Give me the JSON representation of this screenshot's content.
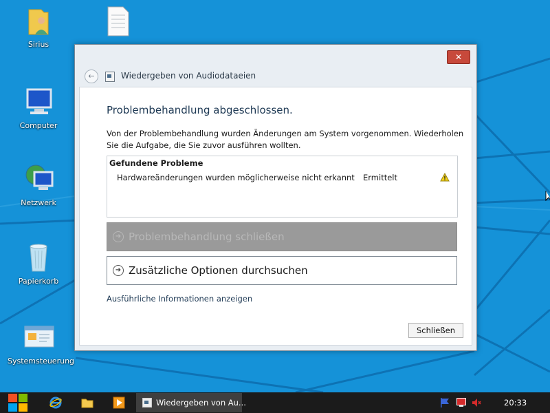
{
  "desktop": {
    "background": "#1592d8",
    "icons": [
      {
        "label": "Sirius",
        "icon": "user-folder-icon"
      },
      {
        "label": "",
        "icon": "text-document-icon"
      },
      {
        "label": "Computer",
        "icon": "computer-icon"
      },
      {
        "label": "Netzwerk",
        "icon": "network-icon"
      },
      {
        "label": "Papierkorb",
        "icon": "recycle-bin-icon"
      },
      {
        "label": "Systemsteuerung",
        "icon": "control-panel-icon"
      }
    ]
  },
  "window": {
    "title": "Wiedergeben von Audiodataeien",
    "close_color": "#c7493b",
    "heading": "Problembehandlung abgeschlossen.",
    "description": "Von der Problembehandlung wurden Änderungen am System vorgenommen. Wiederholen Sie die Aufgabe, die Sie zuvor ausführen wollten.",
    "problems": {
      "title": "Gefundene Probleme",
      "items": [
        {
          "text": "Hardwareänderungen wurden möglicherweise nicht erkannt",
          "status": "Ermittelt",
          "icon": "warning-icon"
        }
      ]
    },
    "commands": {
      "close_troubleshooter": "Problembehandlung schließen",
      "more_options": "Zusätzliche Optionen durchsuchen"
    },
    "details_link": "Ausführliche Informationen anzeigen",
    "close_button": "Schließen"
  },
  "taskbar": {
    "active_task": "Wiedergeben von Au...",
    "clock": "20:33",
    "pinned": [
      "internet-explorer-icon",
      "file-explorer-icon",
      "media-player-icon"
    ],
    "tray": [
      "action-center-flag-icon",
      "network-tray-icon",
      "volume-muted-icon"
    ]
  }
}
